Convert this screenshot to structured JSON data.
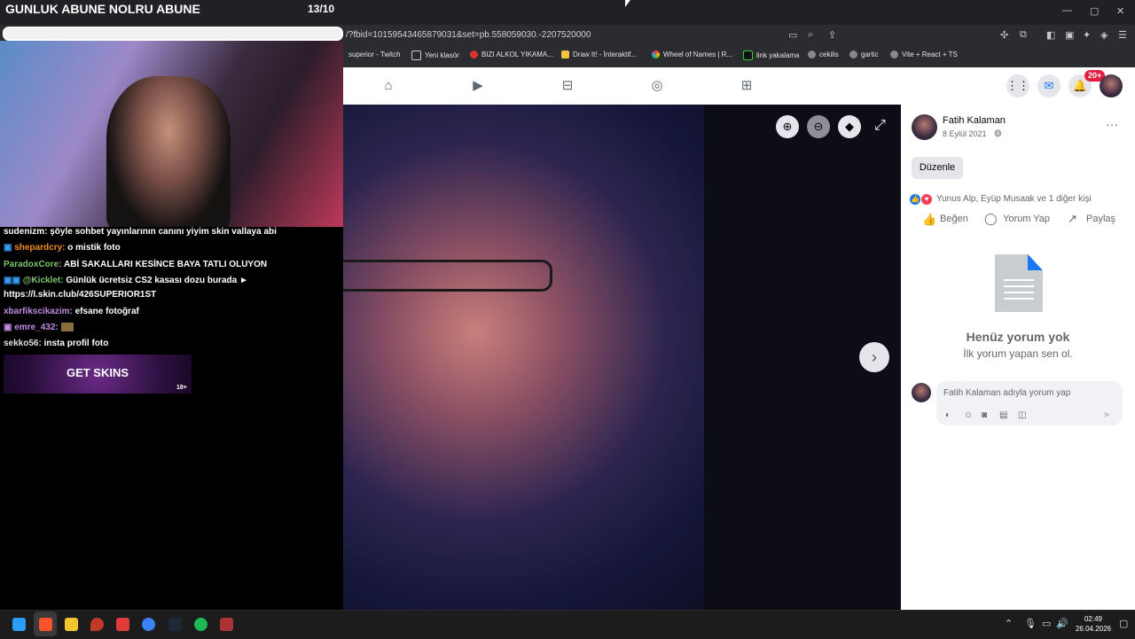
{
  "stream": {
    "title": "GUNLUK ABUNE NOLRU ABUNE",
    "counter": "13/10",
    "chat": [
      {
        "user": "sudenizm:",
        "text": "şöyle sohbet yayınlarının canını yiyim skin vallaya abi",
        "color": "#ffffff"
      },
      {
        "user": "shepardcry:",
        "text": "o mistik foto",
        "color": "#f08a24"
      },
      {
        "user": "ParadoxCore:",
        "text": "ABİ SAKALLARI KESİNCE BAYA TATLI OLUYON",
        "color": "#7cc36d"
      },
      {
        "user": "@Kicklet:",
        "text": "Günlük ücretsiz CS2 kasası dozu burada ►",
        "color": "#7cc36d"
      },
      {
        "user": "",
        "text": "https://l.skin.club/426SUPERIOR1ST",
        "color": "#ffffff"
      },
      {
        "user": "xbarfikscikazim:",
        "text": "efsane fotoğraf",
        "color": "#c08ce4"
      },
      {
        "user": "emre_432:",
        "text": "",
        "color": "#c08ce4"
      },
      {
        "user": "sekko56:",
        "text": "insta profil foto",
        "color": "#e0e0e0"
      }
    ],
    "banner_text": "GET SKINS",
    "banner_age": "18+"
  },
  "browser": {
    "url": "/?fbid=10159543465879031&set=pb.558059030.-2207520000",
    "bookmarks": [
      "superior - Twitch",
      "Yeni klasör",
      "BIZI ALKOL YIKAMA...",
      "Draw It! - İnteraktif...",
      "Wheel of Names | R...",
      "link yakalama",
      "cekilis",
      "gartic",
      "Vite + React + TS"
    ]
  },
  "fb": {
    "notif_badge": "20+",
    "author": "Fatih Kalaman",
    "date": "8 Eylül 2021",
    "edit_label": "Düzenle",
    "reactions": "Yunus Alp, Eyüp Musaak ve 1 diğer kişi",
    "like_label": "Beğen",
    "comment_label": "Yorum Yap",
    "share_label": "Paylaş",
    "no_comments_title": "Henüz yorum yok",
    "no_comments_sub": "İlk yorum yapan sen ol.",
    "comment_placeholder": "Fatih Kalaman adıyla yorum yap"
  },
  "taskbar": {
    "time": "02:49",
    "date": "26.04.2026"
  },
  "colors": {
    "fb_blue": "#1877f2",
    "badge_red": "#e41e3f"
  }
}
